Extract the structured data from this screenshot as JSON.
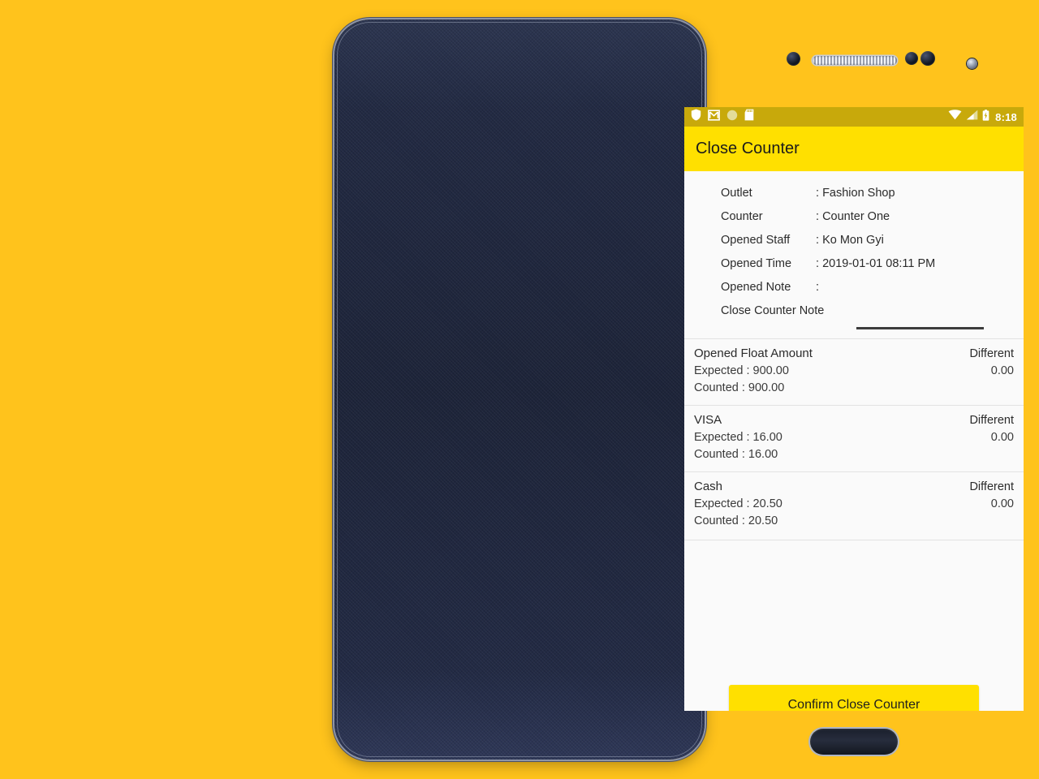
{
  "theme": {
    "page_background": "#FFC31C",
    "appbar_background": "#FFE000",
    "statusbar_background": "#C8A90B",
    "button_background": "#FFE000",
    "screen_background": "#FAFAFA"
  },
  "statusbar": {
    "left_icons": [
      "shield-icon",
      "gmail-icon",
      "dot-icon",
      "sd-card-icon"
    ],
    "right_icons": [
      "wifi-icon",
      "signal-icon",
      "battery-icon"
    ],
    "time": "8:18"
  },
  "appbar": {
    "title": "Close Counter"
  },
  "info": {
    "rows": [
      {
        "label": "Outlet",
        "value": "Fashion Shop"
      },
      {
        "label": "Counter",
        "value": "Counter One"
      },
      {
        "label": "Opened Staff",
        "value": "Ko Mon Gyi"
      },
      {
        "label": "Opened Time",
        "value": "2019-01-01 08:11 PM"
      },
      {
        "label": "Opened Note",
        "value": ""
      }
    ],
    "note_label": "Close Counter Note",
    "note_value": "",
    "note_placeholder": ""
  },
  "amounts": {
    "different_label": "Different",
    "rows": [
      {
        "title": "Opened Float Amount",
        "expected": "Expected : 900.00",
        "counted": "Counted : 900.00",
        "different_label": "Different",
        "different_value": "0.00"
      },
      {
        "title": "VISA",
        "expected": "Expected : 16.00",
        "counted": "Counted : 16.00",
        "different_label": "Different",
        "different_value": "0.00"
      },
      {
        "title": "Cash",
        "expected": "Expected : 20.50",
        "counted": "Counted : 20.50",
        "different_label": "Different",
        "different_value": "0.00"
      }
    ]
  },
  "actions": {
    "confirm_label": "Confirm Close Counter"
  },
  "navbar": {
    "back": "back-triangle-icon",
    "home": "home-circle-icon",
    "recent": "recent-square-icon"
  }
}
